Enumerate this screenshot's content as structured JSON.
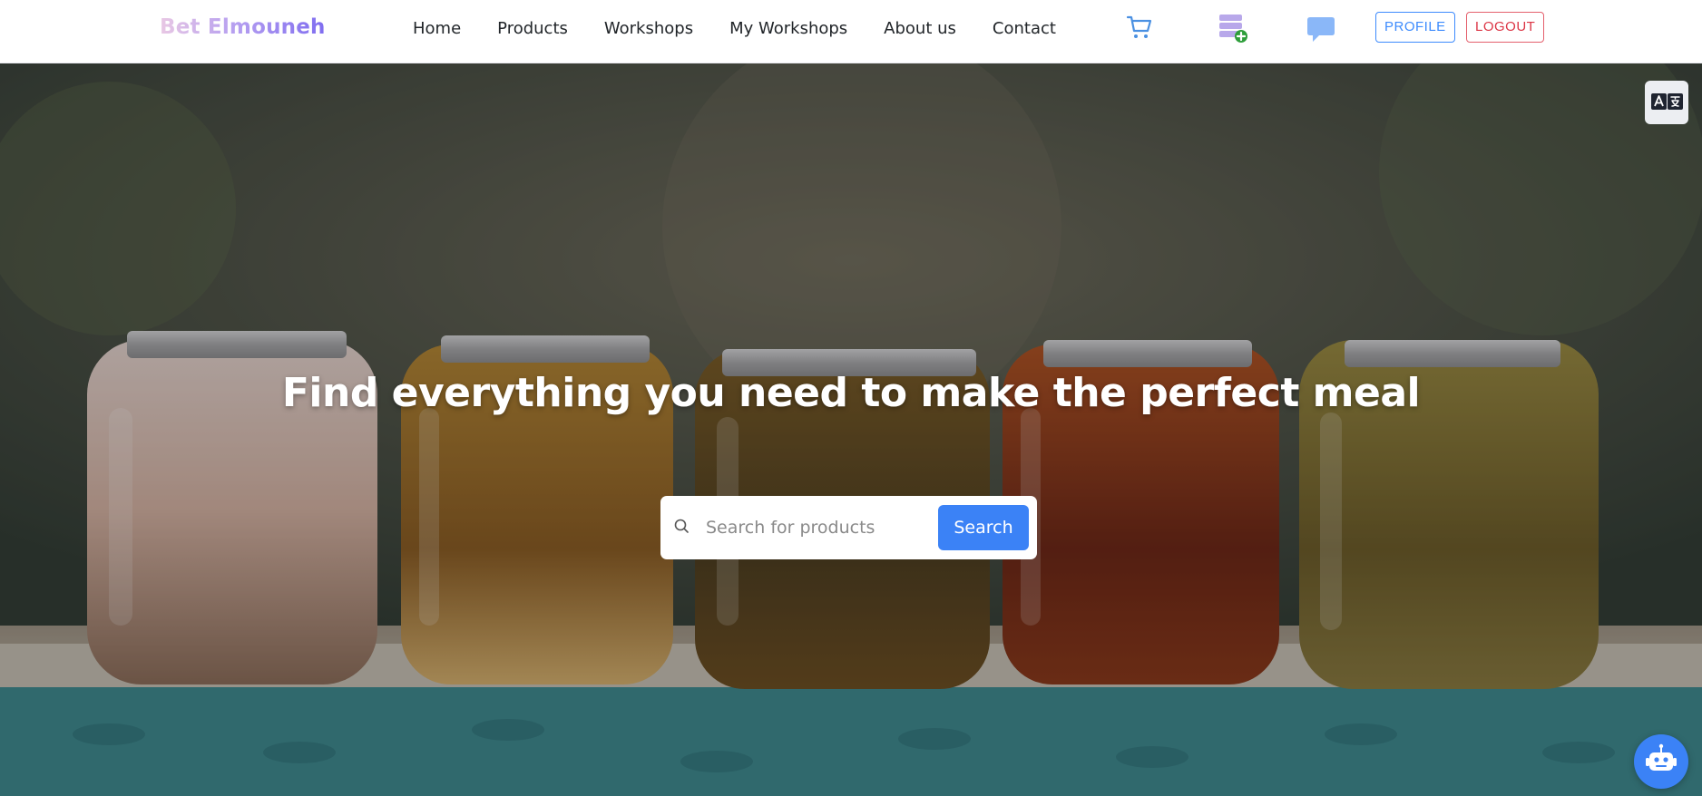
{
  "brand": {
    "name": "Bet Elmouneh"
  },
  "nav": {
    "links": [
      "Home",
      "Products",
      "Workshops",
      "My Workshops",
      "About us",
      "Contact"
    ]
  },
  "header_icons": [
    "cart-icon",
    "add-product-icon",
    "chat-icon"
  ],
  "buttons": {
    "profile": "PROFILE",
    "logout": "LOGOUT"
  },
  "hero": {
    "title": "Find everything you need to make the perfect meal",
    "search": {
      "placeholder": "Search for products",
      "button_label": "Search"
    }
  },
  "floating": {
    "translate_icon": "translate-icon",
    "chatbot_icon": "robot-icon"
  },
  "colors": {
    "brand_gradient": [
      "#e9c8e4",
      "#b69ff0",
      "#7f6df0"
    ],
    "primary": "#3b82f6",
    "profile_border": "#3d8bfd",
    "logout": "#dc3545",
    "add_badge": "#2e9e3a"
  }
}
